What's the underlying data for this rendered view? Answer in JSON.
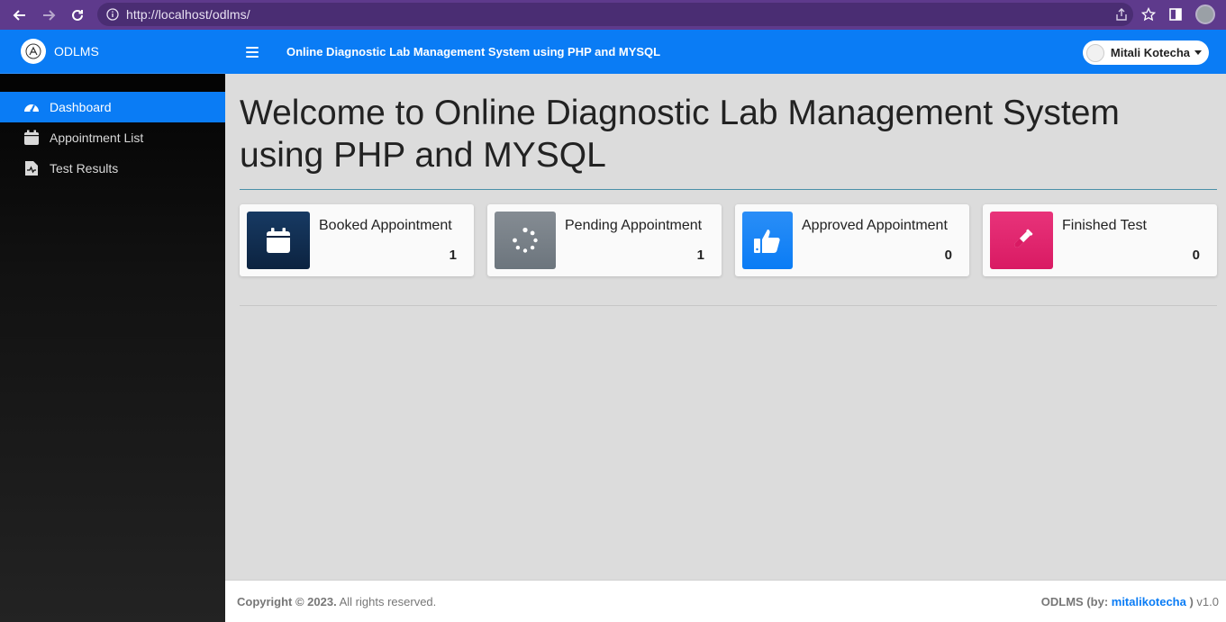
{
  "browser": {
    "url": "http://localhost/odlms/",
    "icons": [
      "back-arrow-icon",
      "forward-arrow-icon",
      "reload-icon",
      "info-icon",
      "share-icon",
      "star-icon",
      "sidepanel-icon",
      "profile-icon"
    ]
  },
  "brand": {
    "name": "ODLMS",
    "icon": "lab-logo-icon"
  },
  "sidebar": {
    "items": [
      {
        "label": "Dashboard",
        "icon": "dashboard-gauge-icon",
        "active": true
      },
      {
        "label": "Appointment List",
        "icon": "calendar-icon",
        "active": false
      },
      {
        "label": "Test Results",
        "icon": "file-medical-icon",
        "active": false
      }
    ]
  },
  "topbar": {
    "title": "Online Diagnostic Lab Management System using PHP and MYSQL",
    "user_name": "Mitali Kotecha"
  },
  "main": {
    "heading": "Welcome to Online Diagnostic Lab Management System using PHP and MYSQL",
    "cards": [
      {
        "label": "Booked Appointment",
        "value": "1",
        "color": "#0c2340",
        "icon": "calendar-icon"
      },
      {
        "label": "Pending Appointment",
        "value": "1",
        "color": "#6c757d",
        "icon": "spinner-icon"
      },
      {
        "label": "Approved Appointment",
        "value": "0",
        "color": "#0a7cf5",
        "icon": "thumbs-up-icon"
      },
      {
        "label": "Finished Test",
        "value": "0",
        "color": "#e0266f",
        "icon": "test-tube-icon"
      }
    ]
  },
  "footer": {
    "copyright": "Copyright © 2023.",
    "rights": " All rights reserved.",
    "app_by": "ODLMS (by: ",
    "author": "mitalikotecha",
    "close": " )",
    "version": " v1.0"
  },
  "colors": {
    "primary": "#0a7cf5",
    "sidebar_bg": "#111111",
    "browser_bar": "#5e3a8c"
  }
}
